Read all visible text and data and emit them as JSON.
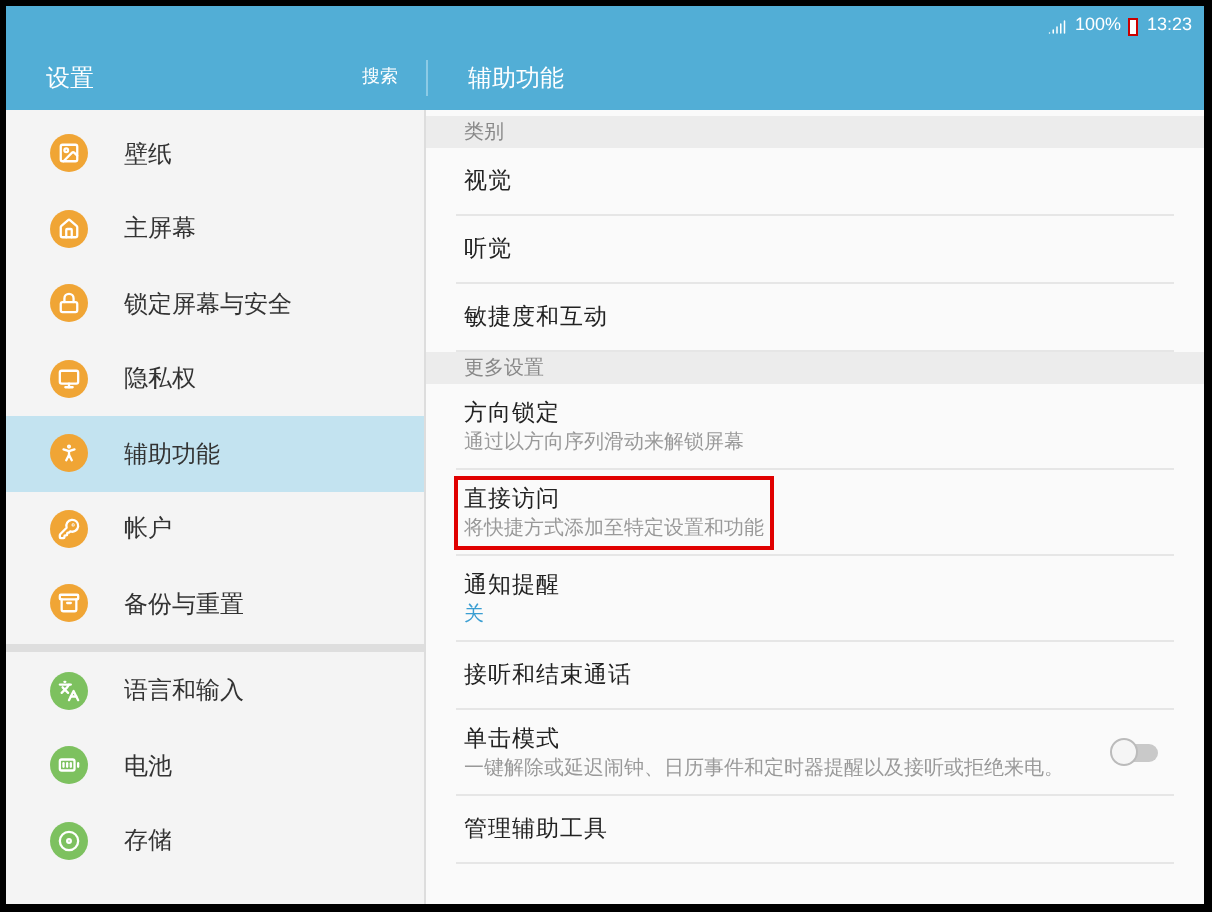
{
  "status_bar": {
    "battery": "100%",
    "time": "13:23"
  },
  "header": {
    "title": "设置",
    "search": "搜索",
    "detail_title": "辅助功能"
  },
  "sidebar": {
    "groups": [
      {
        "items": [
          {
            "label": "壁纸",
            "selected": false
          },
          {
            "label": "主屏幕",
            "selected": false
          },
          {
            "label": "锁定屏幕与安全",
            "selected": false
          },
          {
            "label": "隐私权",
            "selected": false
          },
          {
            "label": "辅助功能",
            "selected": true
          },
          {
            "label": "帐户",
            "selected": false
          },
          {
            "label": "备份与重置",
            "selected": false
          }
        ]
      },
      {
        "items": [
          {
            "label": "语言和输入",
            "selected": false
          },
          {
            "label": "电池",
            "selected": false
          },
          {
            "label": "存储",
            "selected": false
          }
        ]
      }
    ]
  },
  "detail": {
    "rows": [
      {
        "kind": "section",
        "title": "类别"
      },
      {
        "kind": "item",
        "title": "视觉",
        "highlighted": false
      },
      {
        "kind": "item",
        "title": "听觉",
        "highlighted": false
      },
      {
        "kind": "item",
        "title": "敏捷度和互动",
        "highlighted": false
      },
      {
        "kind": "section",
        "title": "更多设置"
      },
      {
        "kind": "item",
        "title": "方向锁定",
        "subtitle": "通过以方向序列滑动来解锁屏幕",
        "highlighted": false
      },
      {
        "kind": "item",
        "title": "直接访问",
        "subtitle": "将快捷方式添加至特定设置和功能",
        "highlighted": true
      },
      {
        "kind": "item",
        "title": "通知提醒",
        "value": "关",
        "highlighted": false
      },
      {
        "kind": "item",
        "title": "接听和结束通话",
        "highlighted": false
      },
      {
        "kind": "toggle",
        "title": "单击模式",
        "subtitle": "一键解除或延迟闹钟、日历事件和定时器提醒以及接听或拒绝来电。",
        "on": false,
        "highlighted": false
      },
      {
        "kind": "item",
        "title": "管理辅助工具",
        "highlighted": false
      }
    ]
  }
}
